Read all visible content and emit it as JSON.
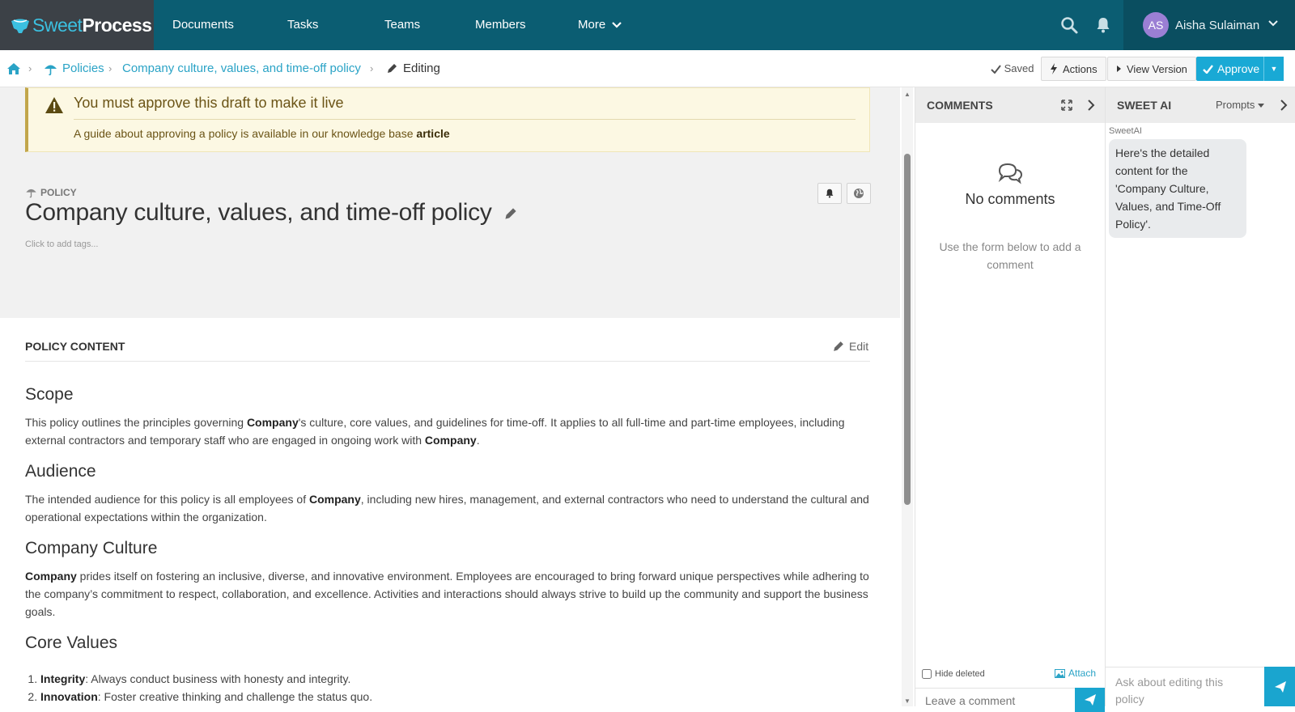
{
  "brand": {
    "sweet": "Sweet",
    "process": "Process"
  },
  "nav": {
    "items": [
      {
        "label": "Documents"
      },
      {
        "label": "Tasks"
      },
      {
        "label": "Teams"
      },
      {
        "label": "Members"
      },
      {
        "label": "More"
      }
    ]
  },
  "user": {
    "initials": "AS",
    "name": "Aisha Sulaiman"
  },
  "breadcrumb": {
    "home_icon": "home-icon",
    "policies": "Policies",
    "document": "Company culture, values, and time-off policy",
    "editing": "Editing"
  },
  "toolbar": {
    "saved": "Saved",
    "actions": "Actions",
    "view_version": "View Version",
    "approve": "Approve"
  },
  "alert": {
    "title": "You must approve this draft to make it live",
    "body": "A guide about approving a policy is available in our knowledge base",
    "link": "article"
  },
  "policy": {
    "type_label": "POLICY",
    "title": "Company culture, values, and time-off policy",
    "tags_hint": "Click to add tags..."
  },
  "content": {
    "heading": "POLICY CONTENT",
    "edit_label": "Edit",
    "sections": [
      {
        "title": "Scope",
        "p1_a": "This policy outlines the principles governing ",
        "p1_b": "Company",
        "p1_c": "'s culture, core values, and guidelines for time-off. It applies to all full-time and part-time employees, including external contractors and temporary staff who are engaged in ongoing work with ",
        "p1_d": "Company",
        "p1_e": "."
      },
      {
        "title": "Audience",
        "p1_a": "The intended audience for this policy is all employees of ",
        "p1_b": "Company",
        "p1_c": ", including new hires, management, and external contractors who need to understand the cultural and operational expectations within the organization."
      },
      {
        "title": "Company Culture",
        "p1_a": "Company",
        "p1_b": " prides itself on fostering an inclusive, diverse, and innovative environment. Employees are encouraged to bring forward unique perspectives while adhering to the company’s commitment to respect, collaboration, and excellence. Activities and interactions should always strive to build up the community and support the business goals."
      },
      {
        "title": "Core Values"
      }
    ],
    "core_values": [
      {
        "name": "Integrity",
        "desc": ": Always conduct business with honesty and integrity."
      },
      {
        "name": "Innovation",
        "desc": ": Foster creative thinking and challenge the status quo."
      }
    ]
  },
  "comments": {
    "title": "COMMENTS",
    "empty_title": "No comments",
    "empty_hint": "Use the form below to add a comment",
    "hide_deleted": "Hide deleted",
    "attach": "Attach",
    "placeholder": "Leave a comment"
  },
  "ai": {
    "title": "SWEET AI",
    "prompts": "Prompts",
    "sender": "SweetAI",
    "message": "Here's the detailed content for the 'Company Culture, Values, and Time-Off Policy'.",
    "placeholder": "Ask about editing this policy"
  },
  "colors": {
    "nav_bg": "#0b5d72",
    "brand_bg": "#3c4147",
    "accent": "#19a9d5",
    "link": "#2aa3c6",
    "alert_bg": "#fcf8e3"
  }
}
